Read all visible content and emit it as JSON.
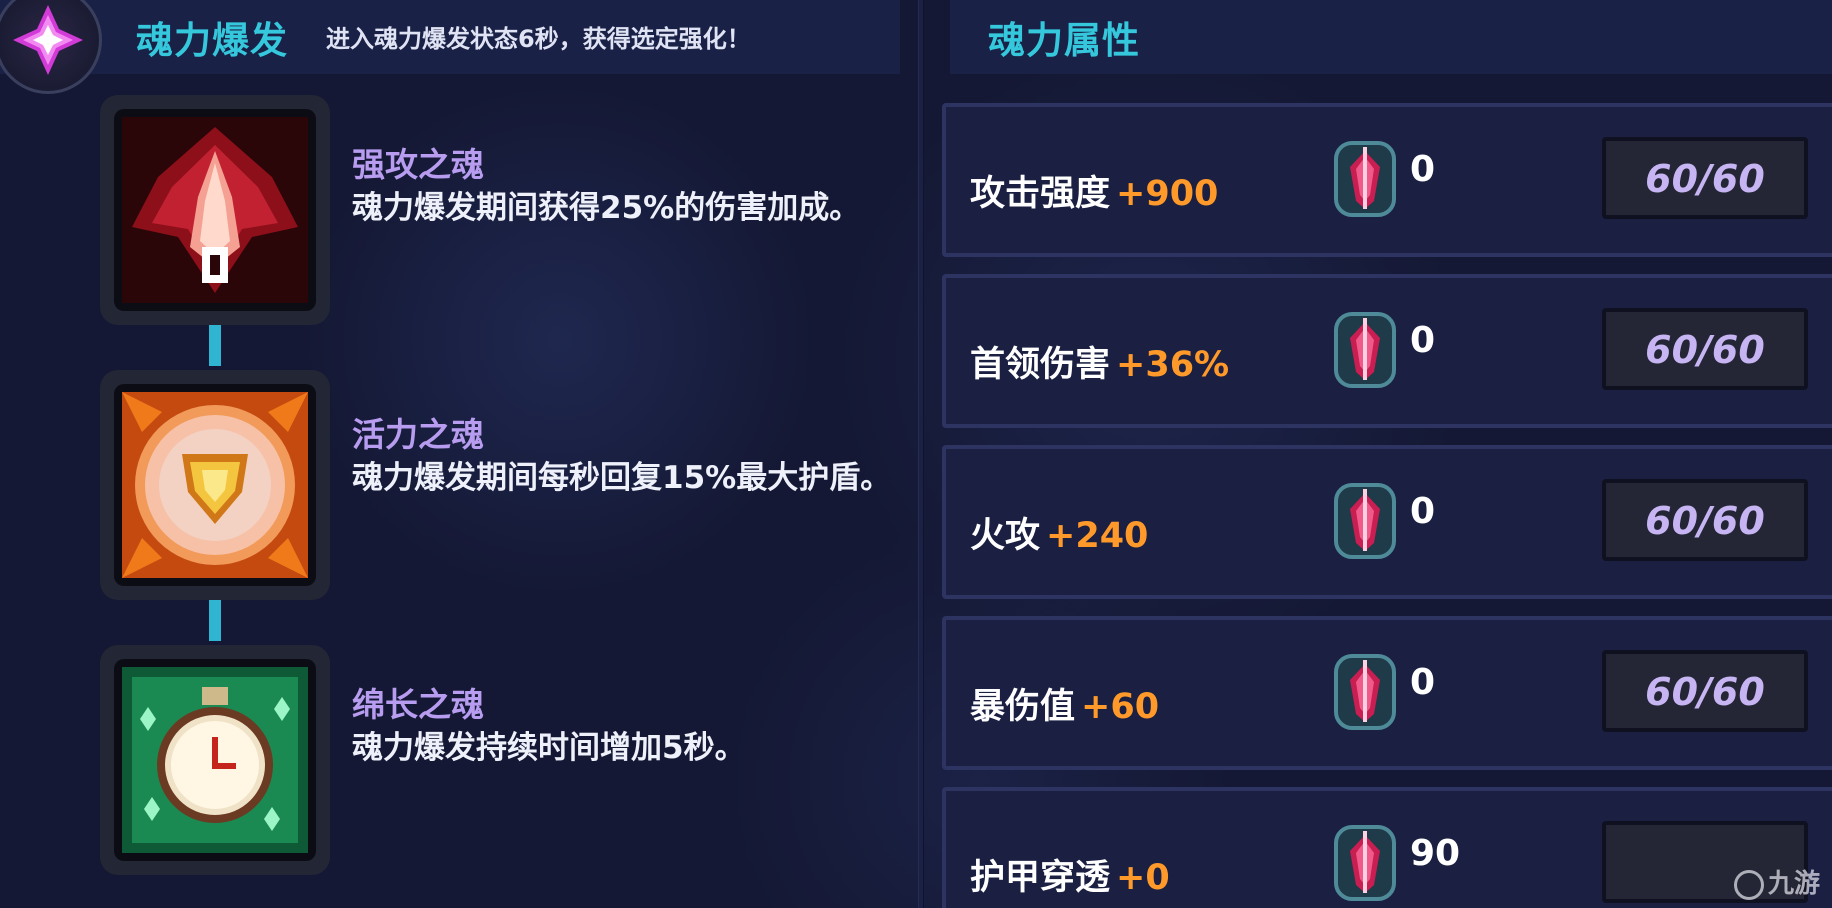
{
  "burst": {
    "title": "魂力爆发",
    "description": "进入魂力爆发状态6秒，获得选定强化！",
    "emblem_icon": "purple-crystal-icon"
  },
  "skills": [
    {
      "name": "强攻之魂",
      "description": "魂力爆发期间获得25%的伤害加成。",
      "icon": "red-sword-soul-icon"
    },
    {
      "name": "活力之魂",
      "description": "魂力爆发期间每秒回复15%最大护盾。",
      "icon": "orange-shield-soul-icon"
    },
    {
      "name": "绵长之魂",
      "description": "魂力爆发持续时间增加5秒。",
      "icon": "green-clock-soul-icon"
    }
  ],
  "attributes": {
    "title": "魂力属性",
    "rows": [
      {
        "label": "攻击强度",
        "bonus": "+900",
        "count": "0",
        "cap": "60/60"
      },
      {
        "label": "首领伤害",
        "bonus": "+36%",
        "count": "0",
        "cap": "60/60"
      },
      {
        "label": "火攻",
        "bonus": "+240",
        "count": "0",
        "cap": "60/60"
      },
      {
        "label": "暴伤值",
        "bonus": "+60",
        "count": "0",
        "cap": "60/60"
      },
      {
        "label": "护甲穿透",
        "bonus": "+0",
        "count": "90",
        "cap": ""
      }
    ],
    "gem_icon": "soul-gem-icon"
  },
  "watermark": "九游",
  "colors": {
    "accent_cyan": "#35c8dd",
    "bonus_orange": "#ff9a2a",
    "skill_name_purple": "#b89cf0",
    "cap_text": "#c6b5f2"
  }
}
